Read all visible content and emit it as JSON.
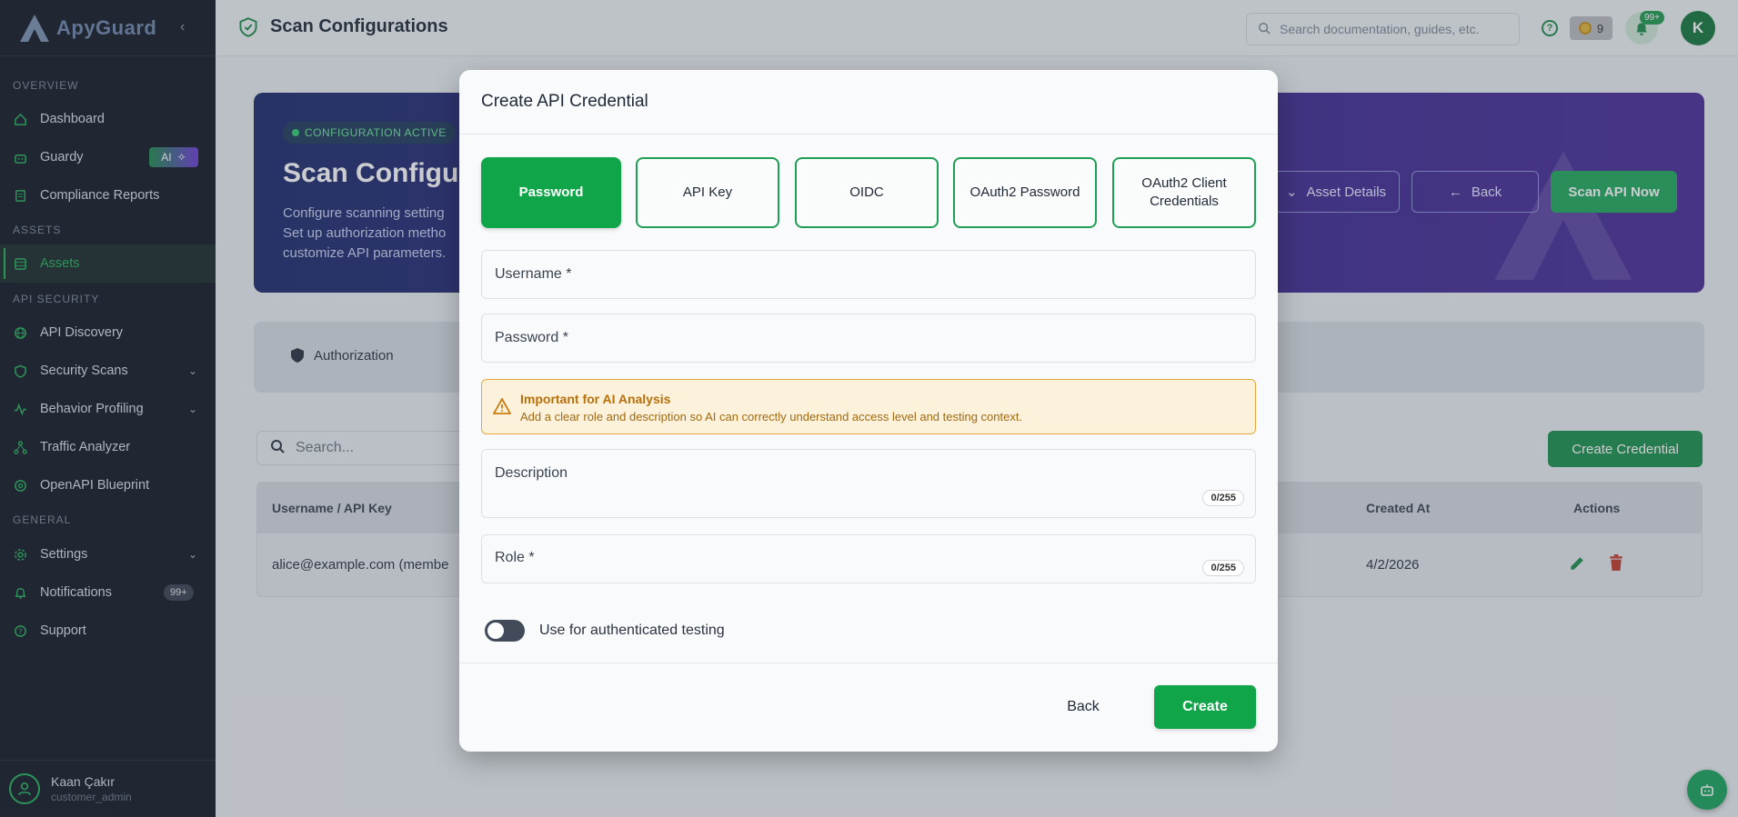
{
  "brand": {
    "name": "ApyGuard"
  },
  "sidebar": {
    "sections": [
      {
        "title": "OVERVIEW"
      },
      {
        "title": "ASSETS"
      },
      {
        "title": "API SECURITY"
      },
      {
        "title": "GENERAL"
      }
    ],
    "items": [
      {
        "label": "Dashboard"
      },
      {
        "label": "Guardy",
        "badge": "AI"
      },
      {
        "label": "Compliance Reports"
      },
      {
        "label": "Assets"
      },
      {
        "label": "API Discovery"
      },
      {
        "label": "Security Scans"
      },
      {
        "label": "Behavior Profiling"
      },
      {
        "label": "Traffic Analyzer"
      },
      {
        "label": "OpenAPI Blueprint"
      },
      {
        "label": "Settings"
      },
      {
        "label": "Notifications",
        "badge": "99+"
      },
      {
        "label": "Support"
      }
    ],
    "user": {
      "name": "Kaan Çakır",
      "role": "customer_admin"
    }
  },
  "topbar": {
    "title": "Scan Configurations",
    "search_placeholder": "Search documentation, guides, etc.",
    "coins": "9",
    "notif_badge": "99+",
    "avatar_initial": "K"
  },
  "hero": {
    "badge": "CONFIGURATION ACTIVE",
    "title": "Scan Configura",
    "desc_lines": [
      "Configure scanning setting",
      "Set up authorization metho",
      "customize API parameters."
    ],
    "btn_asset_details": "Asset Details",
    "btn_back": "Back",
    "btn_scan": "Scan API Now"
  },
  "tabs": {
    "authorization": "Authorization"
  },
  "list": {
    "search_placeholder": "Search...",
    "create_button": "Create Credential",
    "columns": {
      "username": "Username / API Key",
      "created": "Created At",
      "actions": "Actions"
    },
    "rows": [
      {
        "username": "alice@example.com (membe",
        "created": "4/2/2026"
      }
    ]
  },
  "modal": {
    "title": "Create API Credential",
    "types": [
      "Password",
      "API Key",
      "OIDC",
      "OAuth2 Password",
      "OAuth2 Client Credentials"
    ],
    "selected_type": "Password",
    "username_label": "Username *",
    "password_label": "Password *",
    "warning_title": "Important for AI Analysis",
    "warning_text": "Add a clear role and description so AI can correctly understand access level and testing context.",
    "description_label": "Description",
    "description_counter": "0/255",
    "role_label": "Role *",
    "role_counter": "0/255",
    "toggle_label": "Use for authenticated testing",
    "toggle_on": false,
    "back_label": "Back",
    "create_label": "Create"
  },
  "colors": {
    "accent": "#10a549",
    "sidebar_bg": "#131a26",
    "warning_bg": "#fcf2dc"
  }
}
